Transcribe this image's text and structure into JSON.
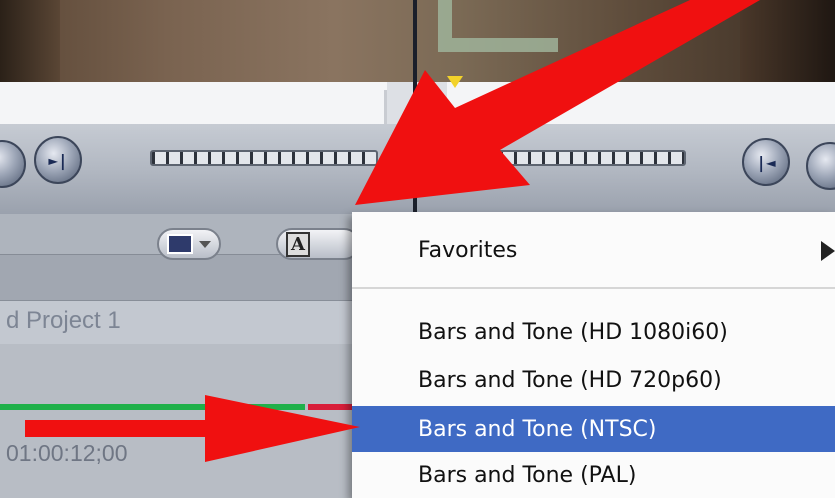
{
  "viewer": {
    "description_icons": [
      "frame-icon"
    ]
  },
  "transport": {
    "left_button_glyph": "►|",
    "right_button_glyph": "|◄"
  },
  "toolbar": {
    "generator_button_letter": "A"
  },
  "timeline": {
    "project_label": "d Project 1",
    "timecode": "01:00:12;00"
  },
  "menu": {
    "items": [
      {
        "label": "Favorites"
      },
      {
        "label": "Bars and Tone (HD 1080i60)"
      },
      {
        "label": "Bars and Tone (HD 720p60)"
      },
      {
        "label": "Bars and Tone (NTSC)"
      },
      {
        "label": "Bars and Tone (PAL)"
      }
    ],
    "selected_index": 3
  },
  "colors": {
    "highlight": "#3f6ac4",
    "annotation_arrow": "#f01010",
    "render_green": "#1fb04a",
    "render_red": "#d81e3a",
    "playhead_marker": "#f2d22a"
  }
}
